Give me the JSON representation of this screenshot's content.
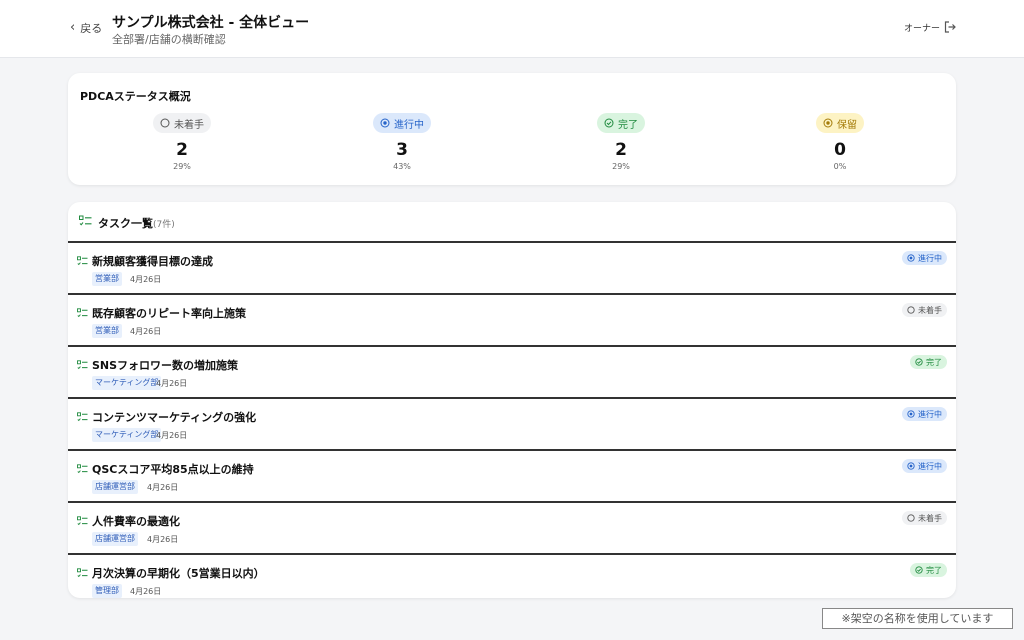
{
  "header": {
    "back_label": "戻る",
    "title": "サンプル株式会社 - 全体ビュー",
    "subtitle": "全部署/店舗の横断確認",
    "user_role": "オーナー"
  },
  "status_overview": {
    "title": "PDCAステータス概況",
    "items": [
      {
        "label": "未着手",
        "count": "2",
        "percent": "29%",
        "icon": "circle-icon",
        "color": "#555555"
      },
      {
        "label": "進行中",
        "count": "3",
        "percent": "43%",
        "icon": "target-icon",
        "color": "#2563c9"
      },
      {
        "label": "完了",
        "count": "2",
        "percent": "29%",
        "icon": "check-circle-icon",
        "color": "#1f8a3e"
      },
      {
        "label": "保留",
        "count": "0",
        "percent": "0%",
        "icon": "pause-circle-icon",
        "color": "#a47b08"
      }
    ]
  },
  "task_list": {
    "title": "タスク一覧",
    "count": "(7件)",
    "tasks": [
      {
        "title": "新規顧客獲得目標の達成",
        "dept": "営業部",
        "date": "4月26日",
        "status": "進行中",
        "status_type": "inprogress"
      },
      {
        "title": "既存顧客のリピート率向上施策",
        "dept": "営業部",
        "date": "4月26日",
        "status": "未着手",
        "status_type": "notstarted"
      },
      {
        "title": "SNSフォロワー数の増加施策",
        "dept": "マーケティング部",
        "date": "4月26日",
        "status": "完了",
        "status_type": "done"
      },
      {
        "title": "コンテンツマーケティングの強化",
        "dept": "マーケティング部",
        "date": "4月26日",
        "status": "進行中",
        "status_type": "inprogress"
      },
      {
        "title": "QSCスコア平均85点以上の維持",
        "dept": "店舗運営部",
        "date": "4月26日",
        "status": "進行中",
        "status_type": "inprogress"
      },
      {
        "title": "人件費率の最適化",
        "dept": "店舗運営部",
        "date": "4月26日",
        "status": "未着手",
        "status_type": "notstarted"
      },
      {
        "title": "月次決算の早期化（5営業日以内）",
        "dept": "管理部",
        "date": "4月26日",
        "status": "完了",
        "status_type": "done"
      }
    ]
  },
  "notice": "※架空の名称を使用しています",
  "colors": {
    "accent_green": "#1f8a3e",
    "accent_blue": "#2563c9",
    "background": "#f4f5f7"
  }
}
